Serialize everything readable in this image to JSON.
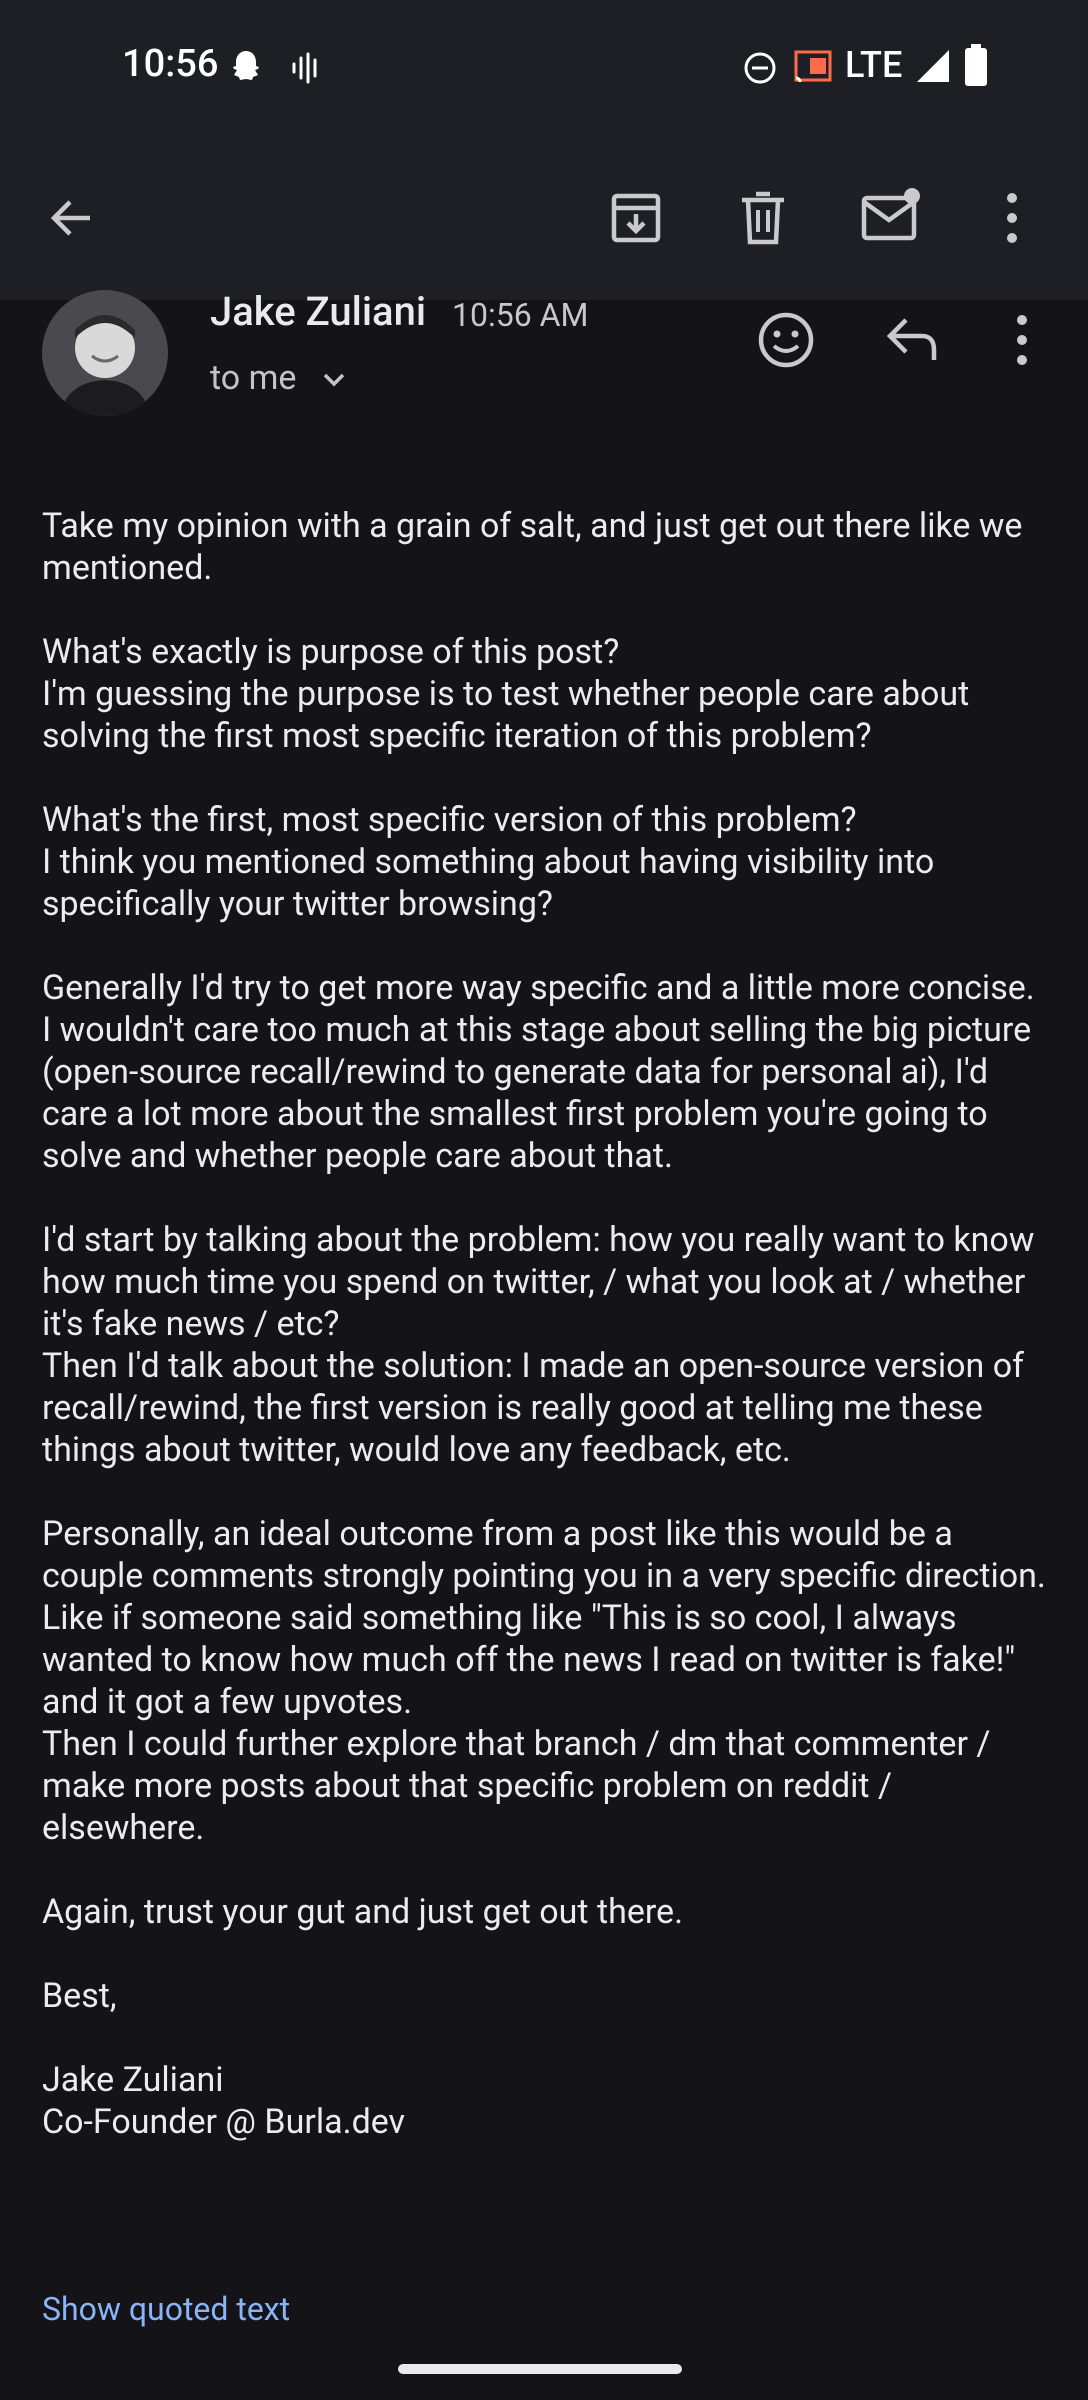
{
  "status_bar": {
    "time": "10:56",
    "network": "LTE",
    "icons": [
      "snapchat-icon",
      "voice-icon",
      "dnd-icon",
      "cast-icon",
      "signal-icon",
      "battery-icon"
    ]
  },
  "toolbar": {
    "icons": [
      "back-arrow-icon",
      "archive-icon",
      "delete-icon",
      "mark-unread-icon",
      "more-vert-icon"
    ]
  },
  "email": {
    "sender": "Jake Zuliani",
    "time": "10:56 AM",
    "to": "to me",
    "paragraphs": [
      [
        "Take my opinion with a grain of salt, and just get out there like we mentioned."
      ],
      [
        "What's exactly is purpose of this post?",
        "I'm guessing the purpose is to test whether people care about solving the first most specific iteration of this problem?"
      ],
      [
        "What's the first, most specific version of this problem?",
        "I think you mentioned something about having visibility into specifically your twitter browsing?"
      ],
      [
        "Generally I'd try to get more way specific and a little more concise. I wouldn't care too much at this stage about selling the big picture (open-source recall/rewind to generate data for personal ai), I'd care a lot more about the smallest first problem you're going to solve and whether people care about that."
      ],
      [
        "I'd start by talking about the problem: how you really want to know how much time you spend on twitter, / what you look at / whether it's fake news / etc?",
        "Then I'd talk about the solution: I made an open-source version of recall/rewind, the first version is really good at telling me these things about twitter, would love any feedback, etc."
      ],
      [
        "Personally, an ideal outcome from a post like this would be a couple comments strongly pointing you in a very specific direction. Like if someone said something like \"This is so cool, I always wanted to know how much off the news I read on twitter is fake!\" and it got a few upvotes.",
        "Then I could further explore that branch / dm that commenter / make more posts about that specific problem on reddit / elsewhere."
      ],
      [
        "Again, trust your gut and just get out there."
      ],
      [
        "Best,"
      ],
      [
        "Jake Zuliani",
        "Co-Founder @ Burla.dev"
      ]
    ],
    "show_quoted": "Show quoted text"
  },
  "colors": {
    "background": "#141418",
    "bar": "#1e1f24",
    "link": "#8ab4f8",
    "text": "#ececf0"
  }
}
